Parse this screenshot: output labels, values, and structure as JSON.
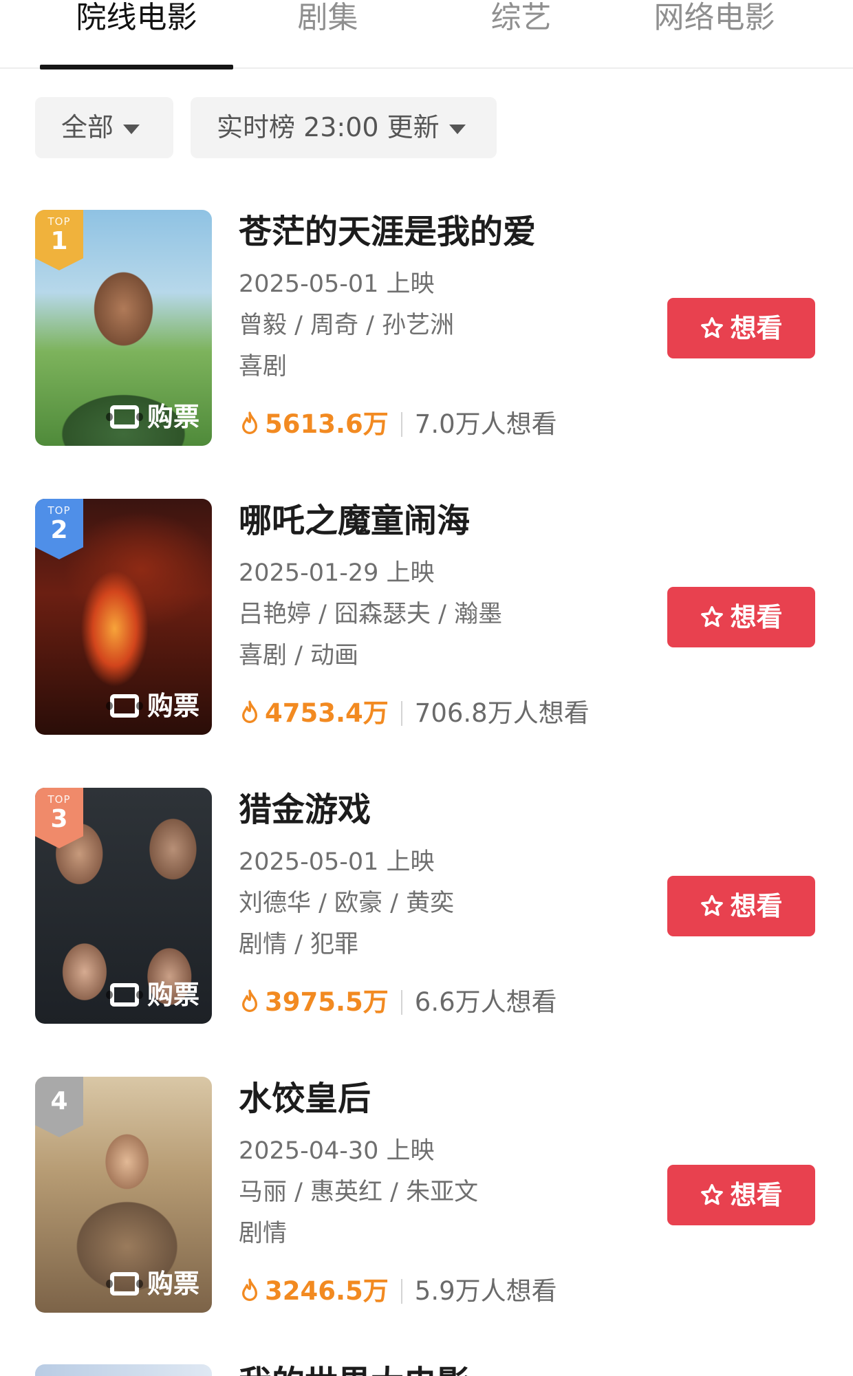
{
  "tabs": [
    {
      "label": "院线电影",
      "active": true
    },
    {
      "label": "剧集",
      "active": false
    },
    {
      "label": "综艺",
      "active": false
    },
    {
      "label": "网络电影",
      "active": false
    }
  ],
  "filters": {
    "category": "全部",
    "ranking": "实时榜 23:00 更新"
  },
  "labels": {
    "buy": "购票",
    "want": "想看",
    "rank_top": "TOP"
  },
  "colors": {
    "accent": "#e8414f",
    "heat": "#f28a21",
    "rank1": "#f0b23c",
    "rank2": "#4f8fe8",
    "rank3": "#f08a6a",
    "rank4": "#a9a9a9"
  },
  "movies": [
    {
      "rank": "1",
      "title": "苍茫的天涯是我的爱",
      "release": "2025-05-01 上映",
      "cast": "曾毅 / 周奇 / 孙艺洲",
      "genre": "喜剧",
      "heat": "5613.6万",
      "wants": "7.0万人想看"
    },
    {
      "rank": "2",
      "title": "哪吒之魔童闹海",
      "release": "2025-01-29 上映",
      "cast": "吕艳婷 / 囧森瑟夫 / 瀚墨",
      "genre": "喜剧 / 动画",
      "heat": "4753.4万",
      "wants": "706.8万人想看"
    },
    {
      "rank": "3",
      "title": "猎金游戏",
      "release": "2025-05-01 上映",
      "cast": "刘德华 / 欧豪 / 黄奕",
      "genre": "剧情 / 犯罪",
      "heat": "3975.5万",
      "wants": "6.6万人想看"
    },
    {
      "rank": "4",
      "title": "水饺皇后",
      "release": "2025-04-30 上映",
      "cast": "马丽 / 惠英红 / 朱亚文",
      "genre": "剧情",
      "heat": "3246.5万",
      "wants": "5.9万人想看"
    }
  ],
  "next_movie_title": "我的世界大电影"
}
